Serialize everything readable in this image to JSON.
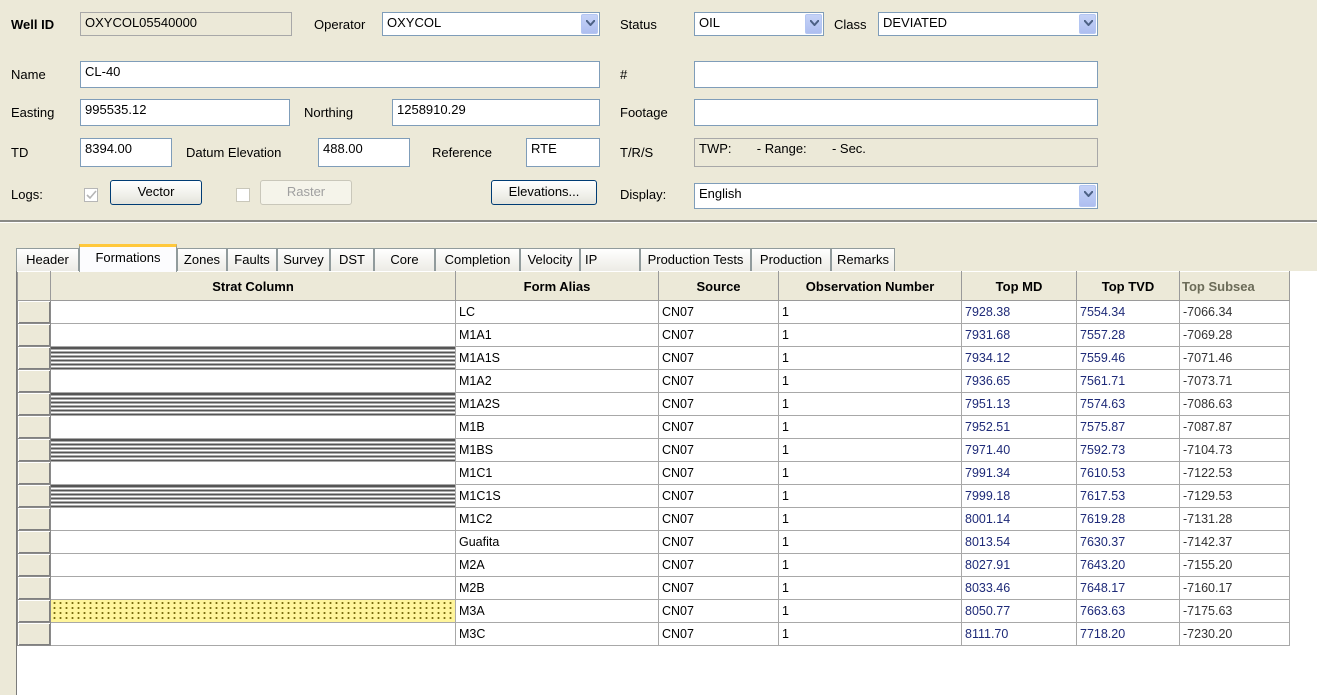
{
  "header": {
    "well_id_label": "Well ID",
    "well_id": "OXYCOL05540000",
    "operator_label": "Operator",
    "operator": "OXYCOL",
    "status_label": "Status",
    "status": "OIL",
    "class_label": "Class",
    "class": "DEVIATED",
    "name_label": "Name",
    "name": "CL-40",
    "hash_label": "#",
    "hash_value": "",
    "easting_label": "Easting",
    "easting": "995535.12",
    "northing_label": "Northing",
    "northing": "1258910.29",
    "footage_label": "Footage",
    "footage": "",
    "td_label": "TD",
    "td": "8394.00",
    "datum_label": "Datum Elevation",
    "datum": "488.00",
    "reference_label": "Reference",
    "reference": "RTE",
    "trs_label": "T/R/S",
    "trs_twp": "TWP:",
    "trs_range": "- Range:",
    "trs_sec": "- Sec.",
    "logs_label": "Logs:",
    "vector_label": "Vector",
    "raster_label": "Raster",
    "elevations_label": "Elevations...",
    "display_label": "Display:",
    "display": "English"
  },
  "tabs": [
    {
      "label": "Header"
    },
    {
      "label": "Formations"
    },
    {
      "label": "Zones"
    },
    {
      "label": "Faults"
    },
    {
      "label": "Survey"
    },
    {
      "label": "DST"
    },
    {
      "label": "Core"
    },
    {
      "label": "Completion"
    },
    {
      "label": "Velocity"
    },
    {
      "label": "IP"
    },
    {
      "label": "Production Tests"
    },
    {
      "label": "Production"
    },
    {
      "label": "Remarks"
    }
  ],
  "active_tab": "Formations",
  "table": {
    "columns": [
      "Strat Column",
      "Form Alias",
      "Source",
      "Observation Number",
      "Top MD",
      "Top TVD",
      "Top Subsea"
    ],
    "rows": [
      {
        "pattern": "",
        "alias": "LC",
        "source": "CN07",
        "obs": "1",
        "md": "7928.38",
        "tvd": "7554.34",
        "subsea": "-7066.34"
      },
      {
        "pattern": "",
        "alias": "M1A1",
        "source": "CN07",
        "obs": "1",
        "md": "7931.68",
        "tvd": "7557.28",
        "subsea": "-7069.28"
      },
      {
        "pattern": "lines",
        "alias": "M1A1S",
        "source": "CN07",
        "obs": "1",
        "md": "7934.12",
        "tvd": "7559.46",
        "subsea": "-7071.46"
      },
      {
        "pattern": "",
        "alias": "M1A2",
        "source": "CN07",
        "obs": "1",
        "md": "7936.65",
        "tvd": "7561.71",
        "subsea": "-7073.71"
      },
      {
        "pattern": "lines",
        "alias": "M1A2S",
        "source": "CN07",
        "obs": "1",
        "md": "7951.13",
        "tvd": "7574.63",
        "subsea": "-7086.63"
      },
      {
        "pattern": "",
        "alias": "M1B",
        "source": "CN07",
        "obs": "1",
        "md": "7952.51",
        "tvd": "7575.87",
        "subsea": "-7087.87"
      },
      {
        "pattern": "lines",
        "alias": "M1BS",
        "source": "CN07",
        "obs": "1",
        "md": "7971.40",
        "tvd": "7592.73",
        "subsea": "-7104.73"
      },
      {
        "pattern": "",
        "alias": "M1C1",
        "source": "CN07",
        "obs": "1",
        "md": "7991.34",
        "tvd": "7610.53",
        "subsea": "-7122.53"
      },
      {
        "pattern": "lines",
        "alias": "M1C1S",
        "source": "CN07",
        "obs": "1",
        "md": "7999.18",
        "tvd": "7617.53",
        "subsea": "-7129.53"
      },
      {
        "pattern": "",
        "alias": "M1C2",
        "source": "CN07",
        "obs": "1",
        "md": "8001.14",
        "tvd": "7619.28",
        "subsea": "-7131.28"
      },
      {
        "pattern": "",
        "alias": "Guafita",
        "source": "CN07",
        "obs": "1",
        "md": "8013.54",
        "tvd": "7630.37",
        "subsea": "-7142.37"
      },
      {
        "pattern": "",
        "alias": "M2A",
        "source": "CN07",
        "obs": "1",
        "md": "8027.91",
        "tvd": "7643.20",
        "subsea": "-7155.20"
      },
      {
        "pattern": "",
        "alias": "M2B",
        "source": "CN07",
        "obs": "1",
        "md": "8033.46",
        "tvd": "7648.17",
        "subsea": "-7160.17"
      },
      {
        "pattern": "dots",
        "alias": "M3A",
        "source": "CN07",
        "obs": "1",
        "md": "8050.77",
        "tvd": "7663.63",
        "subsea": "-7175.63"
      },
      {
        "pattern": "",
        "alias": "M3C",
        "source": "CN07",
        "obs": "1",
        "md": "8111.70",
        "tvd": "7718.20",
        "subsea": "-7230.20"
      }
    ]
  },
  "colors": {
    "window_bg": "#ece9d8",
    "active_tab_accent": "#ffc83c",
    "depth_text": "#1e2a78",
    "sand_pattern": "#fff59c"
  }
}
